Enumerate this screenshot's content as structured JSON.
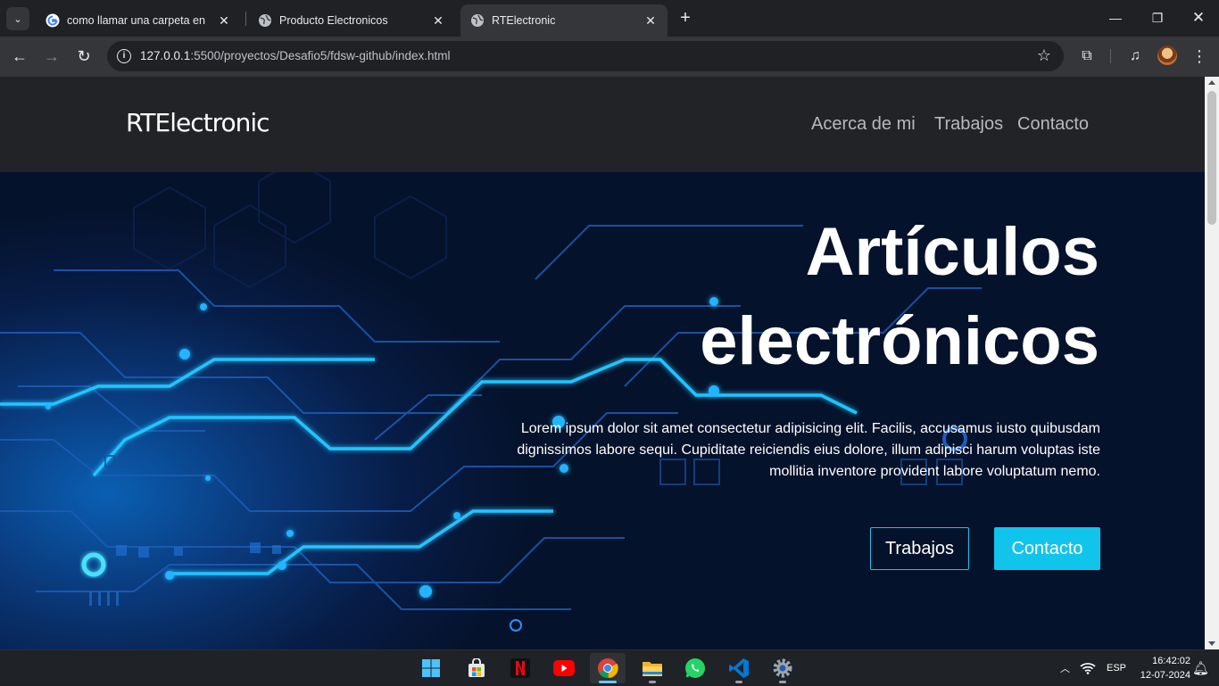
{
  "browser": {
    "tabs": [
      {
        "title": "como llamar una carpeta en html",
        "active": false
      },
      {
        "title": "Producto Electronicos",
        "active": false
      },
      {
        "title": "RTElectronic",
        "active": true
      }
    ],
    "url_host": "127.0.0.1",
    "url_rest": ":5500/proyectos/Desafio5/fdsw-github/index.html"
  },
  "site": {
    "brand": "RTElectronic",
    "nav": [
      "Acerca de mi",
      "Trabajos",
      "Contacto"
    ],
    "hero": {
      "title_line1": "Artículos",
      "title_line2": "electrónicos",
      "text": "Lorem ipsum dolor sit amet consectetur adipisicing elit. Facilis, accusamus iusto quibusdam dignissimos labore sequi. Cupiditate reiciendis eius dolore, illum adipisci harum voluptas iste mollitia inventore provident labore voluptatum nemo.",
      "btn_primary": "Trabajos",
      "btn_secondary": "Contacto"
    }
  },
  "colors": {
    "accent": "#11c4ec",
    "nav_bg": "#222326",
    "hero_bg": "#05122b"
  },
  "taskbar": {
    "apps": [
      "windows-start",
      "microsoft-store",
      "netflix",
      "youtube",
      "chrome",
      "file-explorer",
      "whatsapp",
      "vscode",
      "settings"
    ],
    "language": "ESP",
    "time": "16:42:02",
    "date": "12-07-2024"
  }
}
